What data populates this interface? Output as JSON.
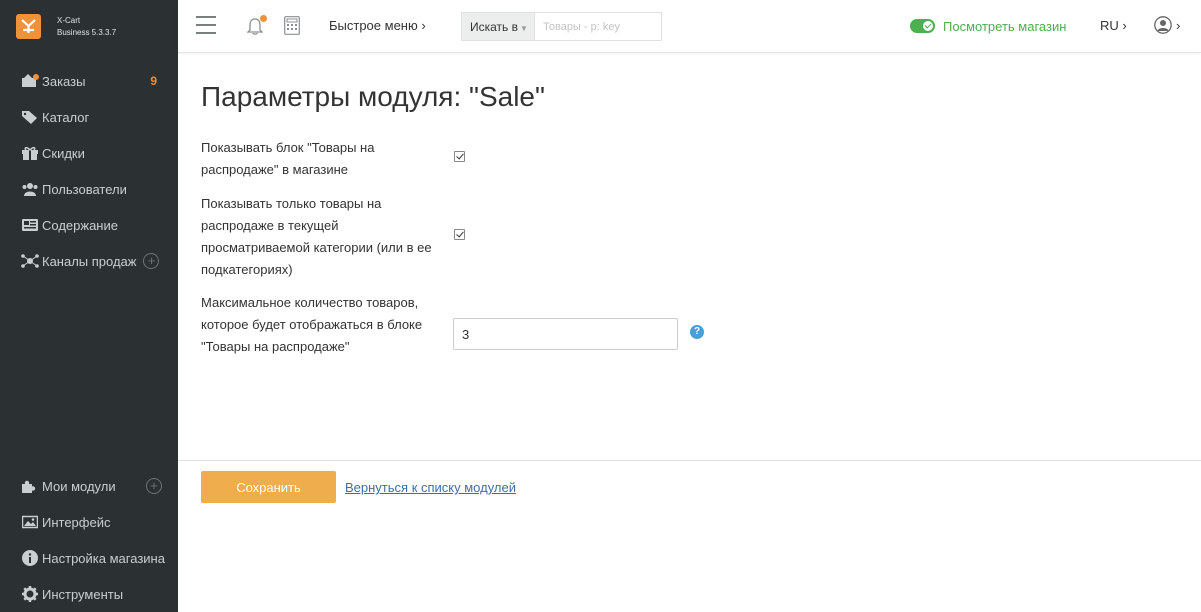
{
  "brand": {
    "name": "X-Cart",
    "edition": "Business 5.3.3.7"
  },
  "sidebar": {
    "items": [
      {
        "label": "Заказы",
        "icon": "orders-icon",
        "badge": "9"
      },
      {
        "label": "Каталог",
        "icon": "tag-icon"
      },
      {
        "label": "Скидки",
        "icon": "gift-icon"
      },
      {
        "label": "Пользователи",
        "icon": "users-icon"
      },
      {
        "label": "Содержание",
        "icon": "content-icon"
      },
      {
        "label": "Каналы продаж",
        "icon": "channels-icon",
        "plus": "+"
      }
    ],
    "bottom_items": [
      {
        "label": "Мои модули",
        "icon": "puzzle-icon",
        "plus": "+"
      },
      {
        "label": "Интерфейс",
        "icon": "image-icon"
      },
      {
        "label": "Настройка магазина",
        "icon": "info-icon"
      },
      {
        "label": "Инструменты",
        "icon": "gear-icon"
      }
    ]
  },
  "header": {
    "quick_menu": "Быстрое меню ›",
    "search_scope": "Искать в",
    "search_placeholder": "Товары - р: key",
    "view_store": "Посмотреть магазин",
    "language": "RU ›",
    "user_caret": "›"
  },
  "main": {
    "title": "Параметры модуля: \"Sale\"",
    "options": [
      {
        "label": "Показывать блок \"Товары на распродаже\" в магазине",
        "checked": true
      },
      {
        "label": "Показывать только товары на распродаже в текущей просматриваемой категории (или в ее подкатегориях)",
        "checked": true
      },
      {
        "label": "Максимальное количество товаров, которое будет отображаться в блоке \"Товары на распродаже\"",
        "value": "3"
      }
    ],
    "help_icon": "?"
  },
  "footer": {
    "save_label": "Сохранить",
    "back_link": "Вернуться к списку модулей"
  },
  "colors": {
    "sidebar_bg": "#2b3132",
    "accent_orange": "#f0913c",
    "save_button": "#f0ad4e",
    "store_green": "#4caf50",
    "link_blue": "#3b6fa8"
  }
}
